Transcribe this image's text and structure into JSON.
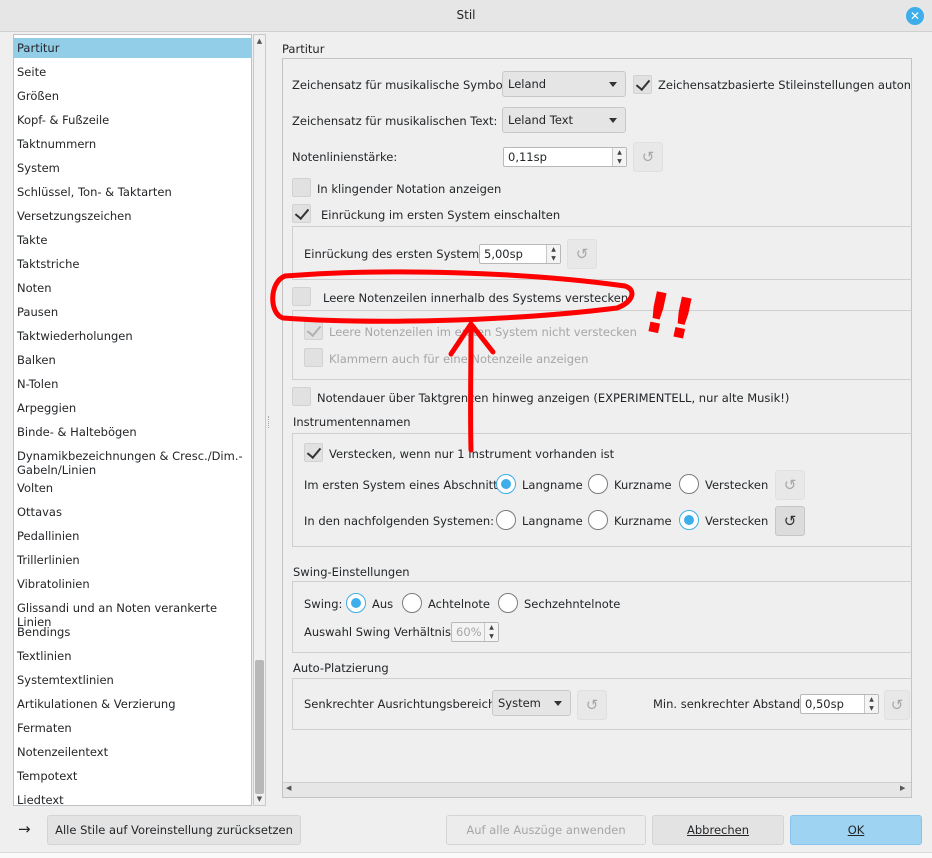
{
  "window": {
    "title": "Stil",
    "close_label": "✕"
  },
  "sidebar": {
    "items": [
      {
        "label": "Partitur",
        "selected": true
      },
      {
        "label": "Seite"
      },
      {
        "label": "Größen"
      },
      {
        "label": "Kopf- & Fußzeile"
      },
      {
        "label": "Taktnummern"
      },
      {
        "label": "System"
      },
      {
        "label": "Schlüssel, Ton- & Taktarten"
      },
      {
        "label": "Versetzungszeichen"
      },
      {
        "label": "Takte"
      },
      {
        "label": "Taktstriche"
      },
      {
        "label": "Noten"
      },
      {
        "label": "Pausen"
      },
      {
        "label": "Taktwiederholungen"
      },
      {
        "label": "Balken"
      },
      {
        "label": "N-Tolen"
      },
      {
        "label": "Arpeggien"
      },
      {
        "label": "Binde- & Haltebögen"
      },
      {
        "label": "Dynamikbezeichnungen & Cresc./Dim.-Gabeln/Linien"
      },
      {
        "label": "Volten"
      },
      {
        "label": "Ottavas"
      },
      {
        "label": "Pedallinien"
      },
      {
        "label": "Trillerlinien"
      },
      {
        "label": "Vibratolinien"
      },
      {
        "label": "Glissandi und an Noten verankerte Linien"
      },
      {
        "label": "Bendings"
      },
      {
        "label": "Textlinien"
      },
      {
        "label": "Systemtextlinien"
      },
      {
        "label": "Artikulationen & Verzierung"
      },
      {
        "label": "Fermaten"
      },
      {
        "label": "Notenzeilentext"
      },
      {
        "label": "Tempotext"
      },
      {
        "label": "Liedtext"
      }
    ]
  },
  "partitur": {
    "section_title": "Partitur",
    "music_font_label": "Zeichensatz für musikalische Symbole:",
    "music_font_value": "Leland",
    "font_based_settings_label": "Zeichensatzbasierte Stileinstellungen automati",
    "font_based_settings_checked": true,
    "text_font_label": "Zeichensatz für musikalischen Text:",
    "text_font_value": "Leland Text",
    "staff_line_width_label": "Notenlinienstärke:",
    "staff_line_width_value": "0,11sp",
    "concert_pitch_label": "In klingender Notation anzeigen",
    "concert_pitch_checked": false,
    "indent_label": "Einrückung im ersten System einschalten",
    "indent_checked": true,
    "indent_value_label": "Einrückung des ersten Systems:",
    "indent_value": "5,00sp",
    "hide_empty_label": "Leere Notenzeilen innerhalb des Systems verstecken",
    "hide_empty_checked": false,
    "dont_hide_first_label": "Leere Notenzeilen im ersten System nicht verstecken",
    "dont_hide_first_checked": true,
    "brackets_label": "Klammern auch für eine Notenzeile anzeigen",
    "brackets_checked": false,
    "note_duration_label": "Notendauer über Taktgrenzen hinweg anzeigen (EXPERIMENTELL, nur alte Musik!)",
    "note_duration_checked": false
  },
  "instruments": {
    "section_title": "Instrumentennamen",
    "hide_single_label": "Verstecken, wenn nur 1 Instrument vorhanden ist",
    "hide_single_checked": true,
    "first_system_label": "Im ersten System eines Abschnitts:",
    "following_label": "In den nachfolgenden Systemen:",
    "opt_long": "Langname",
    "opt_short": "Kurzname",
    "opt_hide": "Verstecken",
    "first_selected": "Langname",
    "following_selected": "Verstecken"
  },
  "swing": {
    "section_title": "Swing-Einstellungen",
    "swing_label": "Swing:",
    "opt_off": "Aus",
    "opt_eighth": "Achtelnote",
    "opt_sixteenth": "Sechzehntelnote",
    "selected": "Aus",
    "ratio_label": "Auswahl Swing Verhältnis:",
    "ratio_value": "60%"
  },
  "autoplace": {
    "section_title": "Auto-Platzierung",
    "vertical_range_label": "Senkrechter Ausrichtungsbereich:",
    "vertical_range_value": "System",
    "min_distance_label": "Min. senkrechter Abstand:",
    "min_distance_value": "0,50sp"
  },
  "footer": {
    "arrow": "→",
    "reset_all_label": "Alle Stile auf Voreinstellung zurücksetzen",
    "apply_all_label": "Auf alle Auszüge anwenden",
    "cancel_label": "Abbrechen",
    "ok_label": "OK"
  },
  "annotation": {
    "marks": "!!",
    "color": "#ff0000"
  },
  "colors": {
    "accent": "#3daee9",
    "selection": "#93cee9",
    "ok_button": "#9ed3f2"
  },
  "icons": {
    "reset": "reset-icon",
    "spin_up": "▲",
    "spin_down": "▼",
    "reset_glyph": "↺"
  }
}
